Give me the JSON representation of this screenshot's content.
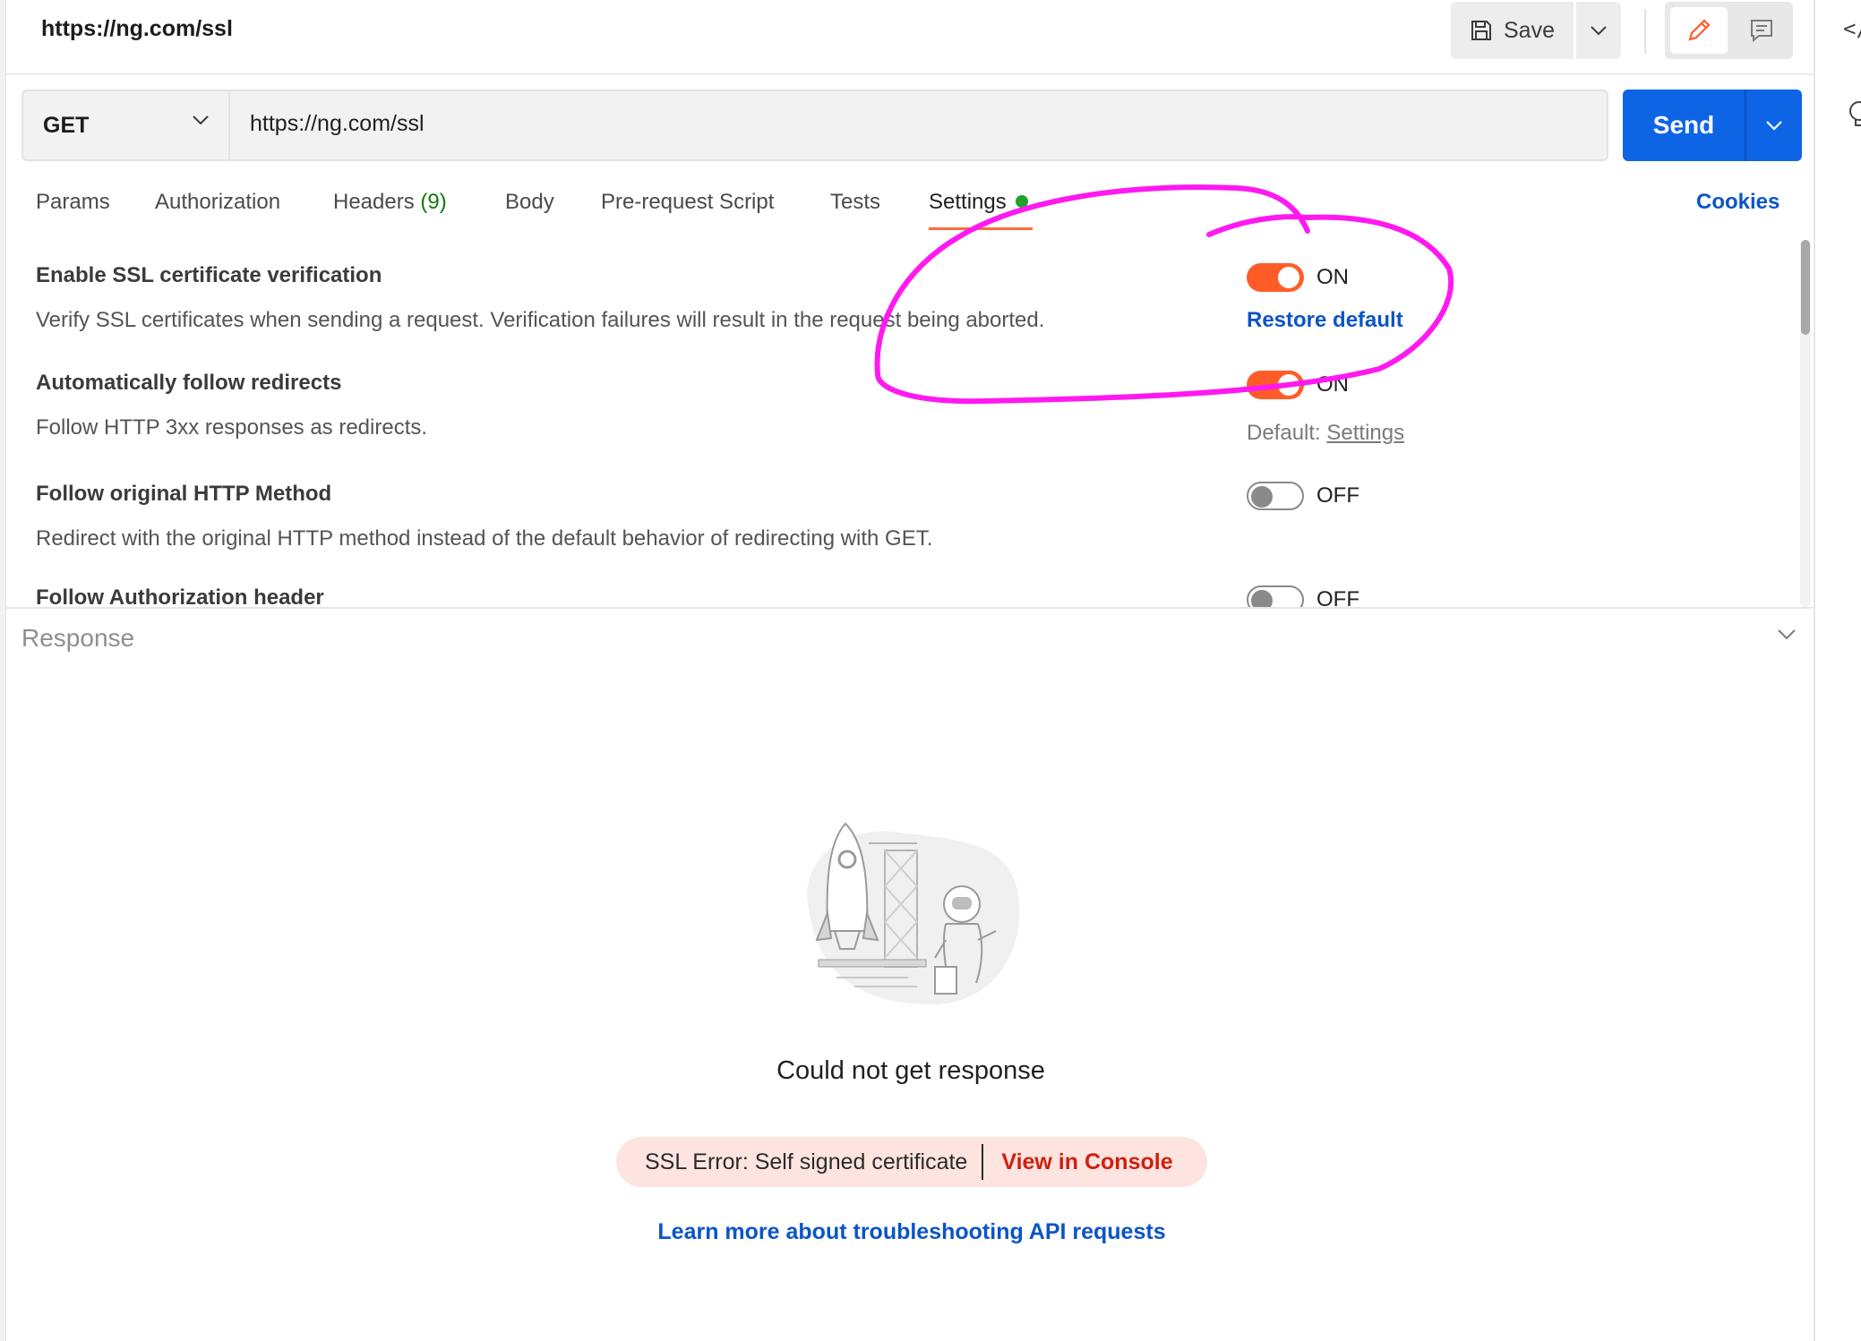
{
  "header": {
    "title": "https://ng.com/ssl",
    "save_label": "Save"
  },
  "request": {
    "method": "GET",
    "url": "https://ng.com/ssl",
    "send_label": "Send"
  },
  "tabs": [
    {
      "label": "Params"
    },
    {
      "label": "Authorization"
    },
    {
      "label": "Headers",
      "count": "(9)"
    },
    {
      "label": "Body"
    },
    {
      "label": "Pre-request Script"
    },
    {
      "label": "Tests"
    },
    {
      "label": "Settings",
      "active": true
    }
  ],
  "cookies_label": "Cookies",
  "settings": [
    {
      "title": "Enable SSL certificate verification",
      "description": "Verify SSL certificates when sending a request. Verification failures will result in the request being aborted.",
      "state": "ON",
      "action": "Restore default"
    },
    {
      "title": "Automatically follow redirects",
      "description": "Follow HTTP 3xx responses as redirects.",
      "state": "ON",
      "default_prefix": "Default:",
      "default_link": "Settings"
    },
    {
      "title": "Follow original HTTP Method",
      "description": "Redirect with the original HTTP method instead of the default behavior of redirecting with GET.",
      "state": "OFF"
    },
    {
      "title": "Follow Authorization header",
      "state": "OFF"
    }
  ],
  "response": {
    "label": "Response",
    "message": "Could not get response",
    "error": "SSL Error: Self signed certificate",
    "view_console": "View in Console",
    "learn_more": "Learn more about troubleshooting API requests"
  },
  "colors": {
    "accent": "#ff6c37",
    "toggle_on": "#ff5c28",
    "send": "#0d65e6",
    "link": "#0b55c6",
    "error": "#d11f0e",
    "annotation": "#ff19f0"
  },
  "icons": [
    "save-icon",
    "chevron-down-icon",
    "pencil-icon",
    "comment-icon",
    "code-icon",
    "lightbulb-icon"
  ]
}
